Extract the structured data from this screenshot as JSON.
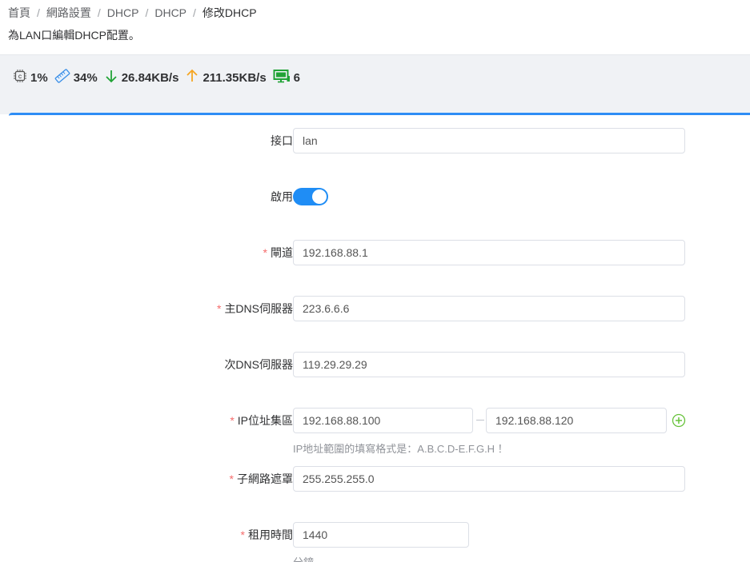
{
  "breadcrumb": {
    "items": [
      "首頁",
      "網路設置",
      "DHCP",
      "DHCP",
      "修改DHCP"
    ],
    "separator": "/"
  },
  "page_description": "為LAN口編輯DHCP配置。",
  "stats": {
    "cpu": "1%",
    "memory": "34%",
    "download": "26.84KB/s",
    "upload": "211.35KB/s",
    "devices": "6"
  },
  "form": {
    "interface": {
      "label": "接口",
      "value": "lan"
    },
    "enable": {
      "label": "啟用",
      "value": true
    },
    "gateway": {
      "label": "閘道",
      "required_mark": "*",
      "value": "192.168.88.1"
    },
    "primary_dns": {
      "label": "主DNS伺服器",
      "required_mark": "*",
      "value": "223.6.6.6"
    },
    "secondary_dns": {
      "label": "次DNS伺服器",
      "value": "119.29.29.29"
    },
    "ip_pool": {
      "label": "IP位址集區",
      "required_mark": "*",
      "start": "192.168.88.100",
      "end": "192.168.88.120",
      "hint": "IP地址範圍的填寫格式是：A.B.C.D-E.F.G.H ！"
    },
    "subnet_mask": {
      "label": "子網路遮罩",
      "required_mark": "*",
      "value": "255.255.255.0"
    },
    "lease_time": {
      "label": "租用時間",
      "required_mark": "*",
      "value": "1440",
      "unit": "分鐘"
    }
  },
  "colors": {
    "accent": "#1f8df5",
    "required": "#f56c6c",
    "download": "#21a336",
    "upload": "#f5a623",
    "devices": "#21a336",
    "memory": "#3a8ee6"
  },
  "icons": {
    "cpu": "cpu-icon",
    "memory": "memory-icon",
    "download": "arrow-down-icon",
    "upload": "arrow-up-icon",
    "devices": "monitor-icon",
    "add": "plus-circle-icon"
  }
}
